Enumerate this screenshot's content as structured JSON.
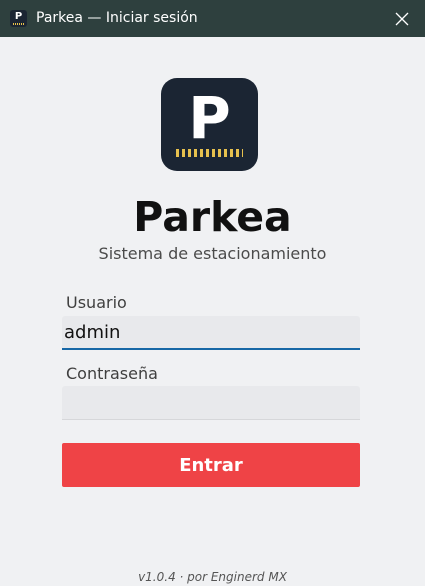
{
  "window": {
    "title": "Parkea — Iniciar sesión",
    "icon_letter": "P"
  },
  "brand": {
    "logo_letter": "P",
    "name": "Parkea",
    "tagline": "Sistema de estacionamiento"
  },
  "form": {
    "username_label": "Usuario",
    "username_value": "admin",
    "password_label": "Contraseña",
    "password_value": "",
    "submit_label": "Entrar"
  },
  "footer": {
    "text": "v1.0.4  · por Enginerd MX"
  },
  "colors": {
    "titlebar": "#2e403e",
    "logo_background": "#1b2533",
    "logo_stripe": "#e7c14e",
    "primary_button": "#ef4346",
    "focus_underline": "#1767a6"
  },
  "icons": {
    "close": "close-icon",
    "app": "parkea-app-icon"
  }
}
